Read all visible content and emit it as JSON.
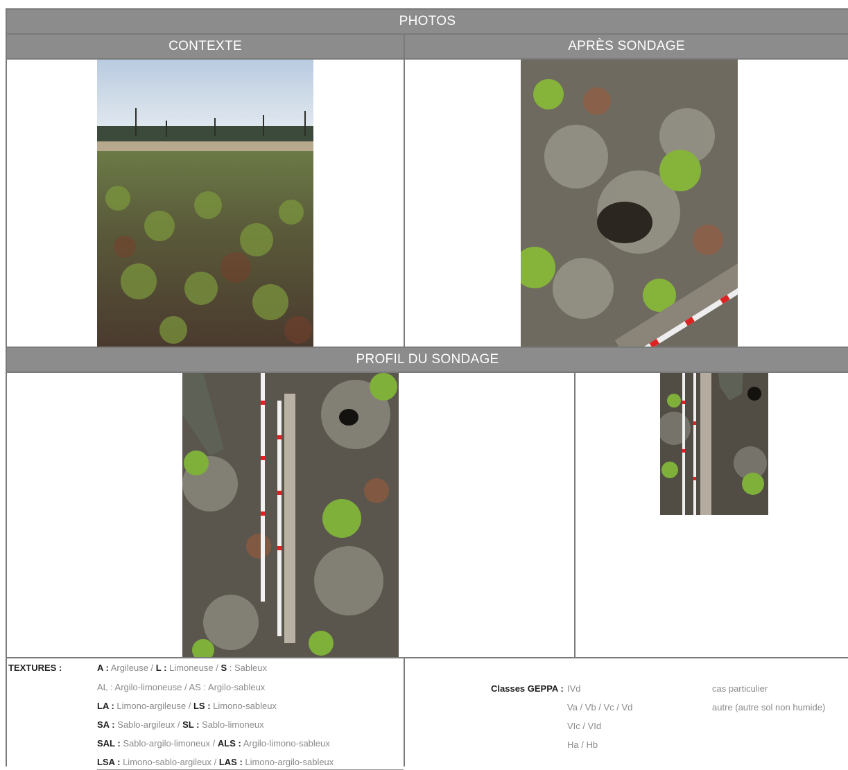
{
  "sections": {
    "photos": "PHOTOS",
    "contexte": "CONTEXTE",
    "apres_sondage": "APRÈS SONDAGE",
    "profil": "PROFIL DU SONDAGE"
  },
  "legend": {
    "title": "TEXTURES :",
    "rows": [
      [
        {
          "code": "A :",
          "name": " Argileuse / "
        },
        {
          "code": "L :",
          "name": " Limoneuse / "
        },
        {
          "code": "S",
          "name": " : Sableux"
        }
      ],
      [
        {
          "code": "",
          "name": "AL : Argilo-limoneuse / AS : Argilo-sableux"
        }
      ],
      [
        {
          "code": "LA :",
          "name": " Limono-argileuse / "
        },
        {
          "code": "LS :",
          "name": " Limono-sableux"
        }
      ],
      [
        {
          "code": "SA :",
          "name": " Sablo-argileux / "
        },
        {
          "code": "SL :",
          "name": " Sablo-limoneux"
        }
      ],
      [
        {
          "code": "SAL :",
          "name": " Sablo-argilo-limoneux  / "
        },
        {
          "code": "ALS :",
          "name": " Argilo-limono-sableux"
        }
      ],
      [
        {
          "code": "LSA :",
          "name": " Limono-sablo-argileux / "
        },
        {
          "code": "LAS :",
          "name": " Limono-argilo-sableux"
        }
      ]
    ]
  },
  "geppa": {
    "label": "Classes GEPPA :",
    "classes": [
      "IVd",
      "Va / Vb / Vc / Vd",
      "VIc / VId",
      "Ha / Hb"
    ],
    "notes": [
      "cas particulier",
      "autre (autre sol non humide)"
    ]
  },
  "colors": {
    "header_bg": "#8c8c8c",
    "border": "#7a7a7a"
  }
}
